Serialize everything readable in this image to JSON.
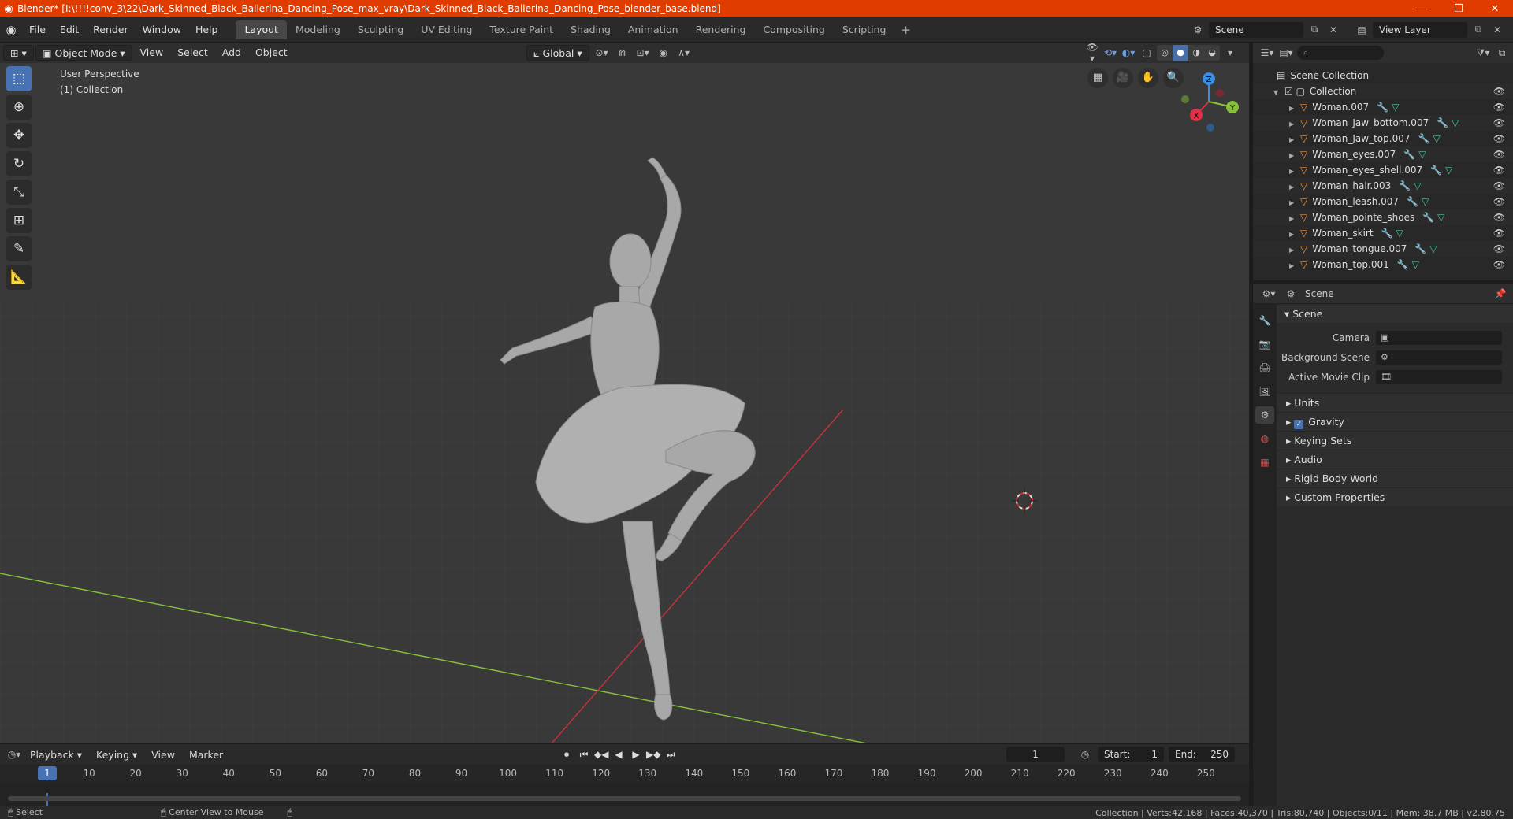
{
  "window": {
    "title": "Blender* [I:\\!!!!conv_3\\22\\Dark_Skinned_Black_Ballerina_Dancing_Pose_max_vray\\Dark_Skinned_Black_Ballerina_Dancing_Pose_blender_base.blend]"
  },
  "menu": {
    "items": [
      "File",
      "Edit",
      "Render",
      "Window",
      "Help"
    ],
    "workspaces": [
      "Layout",
      "Modeling",
      "Sculpting",
      "UV Editing",
      "Texture Paint",
      "Shading",
      "Animation",
      "Rendering",
      "Compositing",
      "Scripting"
    ],
    "active_workspace": "Layout",
    "scene_name": "Scene",
    "view_layer": "View Layer"
  },
  "viewport": {
    "mode": "Object Mode",
    "menus": [
      "View",
      "Select",
      "Add",
      "Object"
    ],
    "transform_orientation": "Global",
    "info_line1": "User Perspective",
    "info_line2": "(1) Collection",
    "gizmo_axes": {
      "x": "X",
      "y": "Y",
      "z": "Z"
    }
  },
  "outliner": {
    "root": "Scene Collection",
    "collection": "Collection",
    "objects": [
      {
        "name": "Woman.007"
      },
      {
        "name": "Woman_Jaw_bottom.007"
      },
      {
        "name": "Woman_Jaw_top.007"
      },
      {
        "name": "Woman_eyes.007"
      },
      {
        "name": "Woman_eyes_shell.007"
      },
      {
        "name": "Woman_hair.003"
      },
      {
        "name": "Woman_leash.007"
      },
      {
        "name": "Woman_pointe_shoes"
      },
      {
        "name": "Woman_skirt"
      },
      {
        "name": "Woman_tongue.007"
      },
      {
        "name": "Woman_top.001"
      }
    ]
  },
  "properties": {
    "context": "Scene",
    "section": "Scene",
    "camera_label": "Camera",
    "background_scene_label": "Background Scene",
    "active_movie_clip_label": "Active Movie Clip",
    "panels": [
      "Units",
      "Gravity",
      "Keying Sets",
      "Audio",
      "Rigid Body World",
      "Custom Properties"
    ],
    "gravity_enabled": true
  },
  "timeline": {
    "menus": [
      "Playback",
      "Keying",
      "View",
      "Marker"
    ],
    "current_frame": "1",
    "start_label": "Start:",
    "start": "1",
    "end_label": "End:",
    "end": "250",
    "ticks": [
      "10",
      "20",
      "30",
      "40",
      "50",
      "60",
      "70",
      "80",
      "90",
      "100",
      "110",
      "120",
      "130",
      "140",
      "150",
      "160",
      "170",
      "180",
      "190",
      "200",
      "210",
      "220",
      "230",
      "240",
      "250"
    ]
  },
  "status": {
    "left_action": "Select",
    "middle_action": "Center View to Mouse",
    "stats": "Collection | Verts:42,168 | Faces:40,370 | Tris:80,740 | Objects:0/11 | Mem: 38.7 MB | v2.80.75"
  },
  "colors": {
    "accent": "#4772b3",
    "titlebar": "#e03c00",
    "x_axis": "#e0304a",
    "y_axis": "#86c13a",
    "z_axis": "#3b8fe3"
  }
}
